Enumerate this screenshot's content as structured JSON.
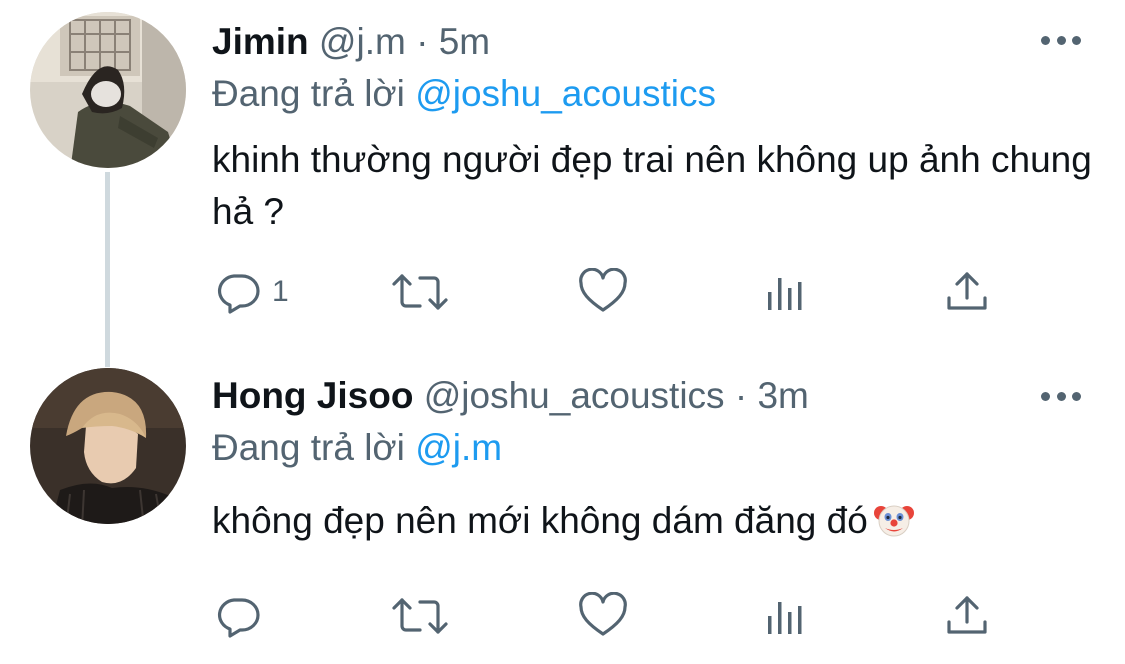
{
  "tweets": [
    {
      "author": {
        "name": "Jimin",
        "handle": "@j.m",
        "time": "5m",
        "avatar": "avatar-photo-jimin"
      },
      "separator": "·",
      "reply_prefix": "Đang trả lời",
      "reply_to": "@joshu_acoustics",
      "text": "khinh thường người đẹp trai nên không up ảnh chung hả ?",
      "emoji": "",
      "actions": {
        "reply_count": "1",
        "retweet_count": "",
        "like_count": ""
      }
    },
    {
      "author": {
        "name": "Hong Jisoo",
        "handle": "@joshu_acoustics",
        "time": "3m",
        "avatar": "avatar-photo-jisoo"
      },
      "separator": "·",
      "reply_prefix": "Đang trả lời",
      "reply_to": "@j.m",
      "text": "không đẹp nên mới không dám đăng đó",
      "emoji": "clown-face-emoji",
      "actions": {
        "reply_count": "",
        "retweet_count": "",
        "like_count": ""
      }
    }
  ],
  "icons": {
    "reply": "reply-icon",
    "retweet": "retweet-icon",
    "like": "heart-icon",
    "analytics": "analytics-icon",
    "share": "share-icon",
    "more": "more-icon"
  },
  "colors": {
    "text": "#0f1419",
    "secondary": "#536471",
    "link": "#1d9bf0",
    "thread_line": "#cfd9de"
  }
}
